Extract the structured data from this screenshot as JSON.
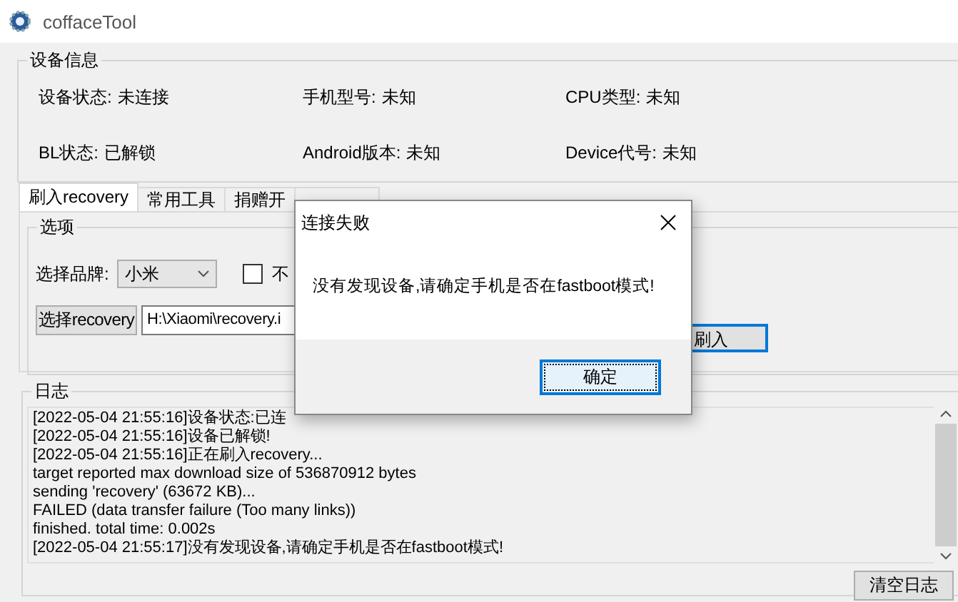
{
  "window": {
    "title": "coffaceTool"
  },
  "device_info": {
    "title": "设备信息",
    "fields": [
      {
        "label": "设备状态:",
        "value": "未连接"
      },
      {
        "label": "手机型号:",
        "value": "未知"
      },
      {
        "label": "CPU类型:",
        "value": "未知"
      },
      {
        "label": "BL状态:",
        "value": "已解锁"
      },
      {
        "label": "Android版本:",
        "value": "未知"
      },
      {
        "label": "Device代号:",
        "value": "未知"
      }
    ]
  },
  "tabs": [
    {
      "label": "刷入recovery",
      "selected": true
    },
    {
      "label": "常用工具",
      "selected": false
    },
    {
      "label": "捐赠开",
      "selected": false
    }
  ],
  "options": {
    "title": "选项",
    "brand_label": "选择品牌:",
    "brand_value": "小米",
    "checkbox": {
      "label": "不",
      "checked": false
    },
    "choose_button": "选择recovery",
    "path_value": "H:\\Xiaomi\\recovery.i",
    "flash_button": "刷入"
  },
  "log": {
    "title": "日志",
    "lines": [
      "[2022-05-04 21:55:16]设备状态:已连",
      "[2022-05-04 21:55:16]设备已解锁!",
      "[2022-05-04 21:55:16]正在刷入recovery...",
      "target reported max download size of 536870912 bytes",
      "sending 'recovery' (63672 KB)...",
      "FAILED (data transfer failure (Too many links))",
      "finished. total time: 0.002s",
      "[2022-05-04 21:55:17]没有发现设备,请确定手机是否在fastboot模式!"
    ],
    "clear_button": "清空日志"
  },
  "dialog": {
    "title": "连接失败",
    "message": "没有发现设备,请确定手机是否在fastboot模式!",
    "ok_button": "确定"
  }
}
